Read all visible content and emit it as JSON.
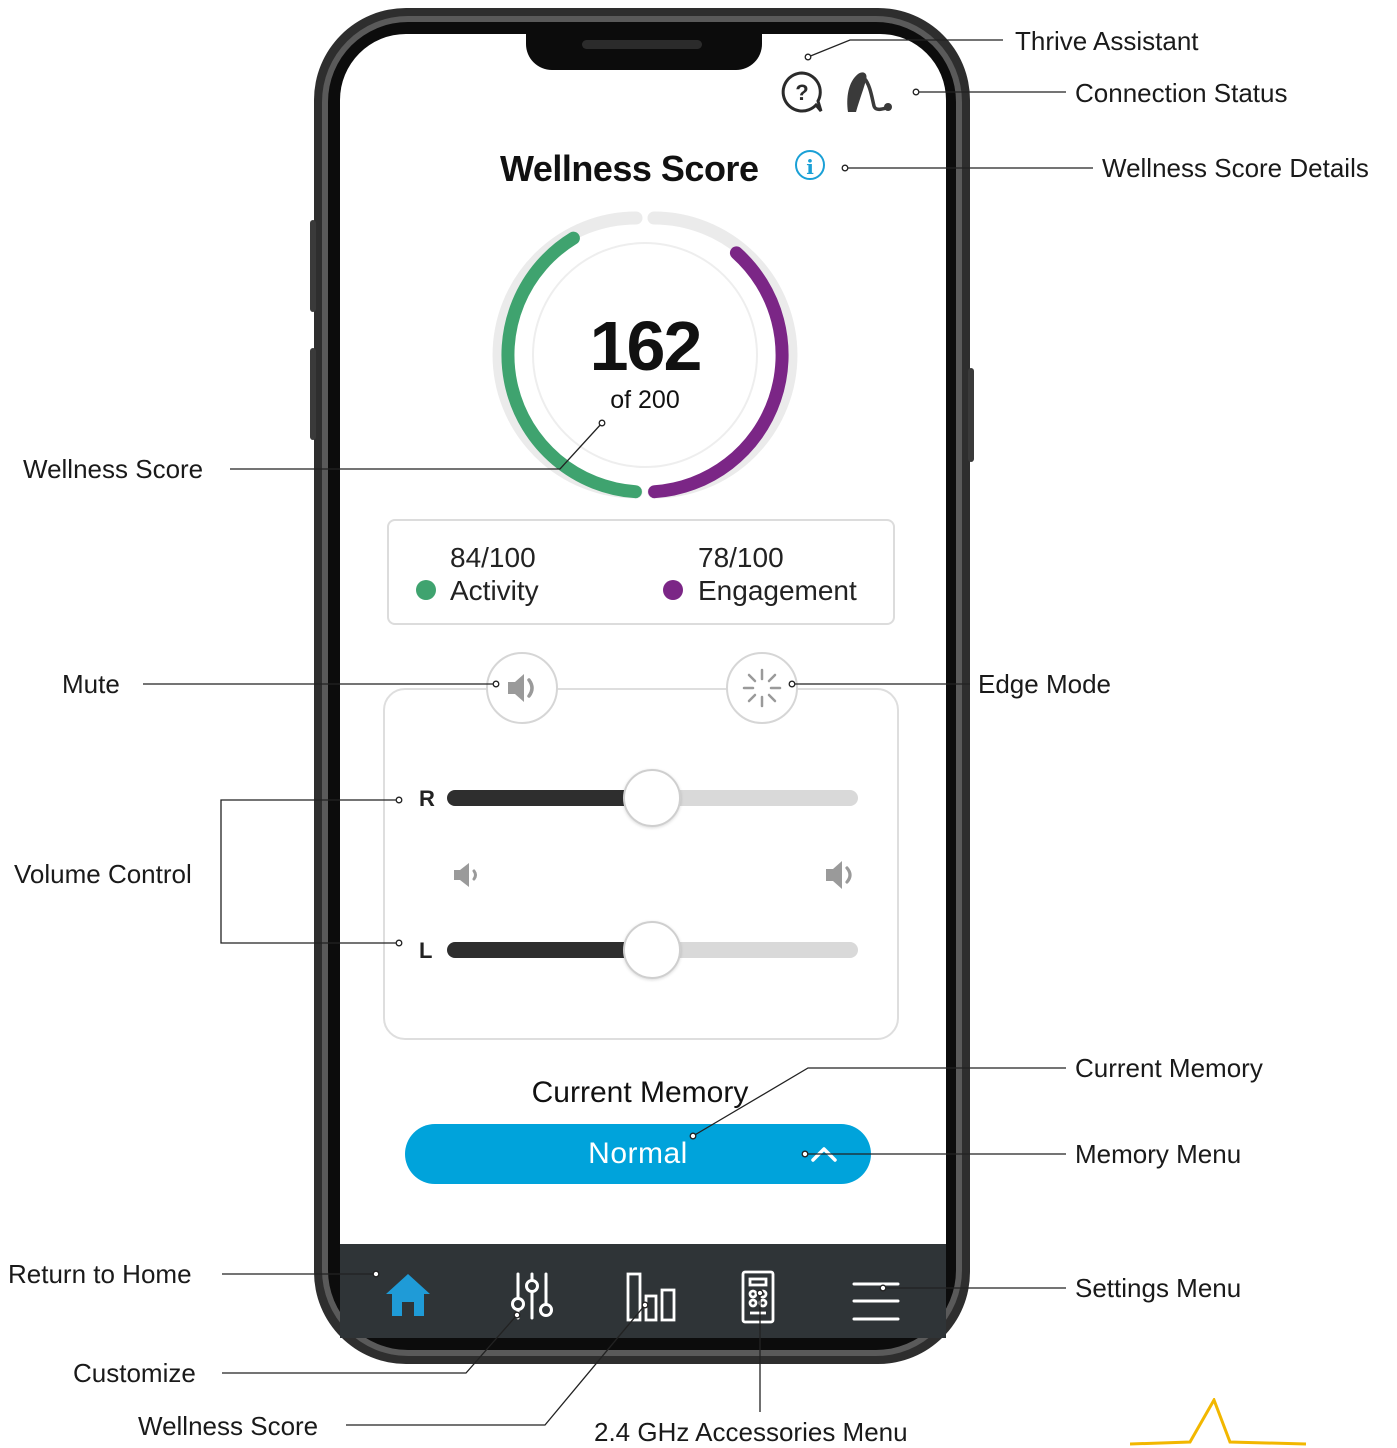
{
  "annotations": {
    "thrive_assistant": "Thrive Assistant",
    "connection_status": "Connection Status",
    "wellness_score_details": "Wellness Score Details",
    "wellness_score": "Wellness Score",
    "mute": "Mute",
    "edge_mode": "Edge Mode",
    "volume_control": "Volume Control",
    "current_memory": "Current Memory",
    "memory_menu": "Memory Menu",
    "return_to_home": "Return to Home",
    "settings_menu": "Settings Menu",
    "customize": "Customize",
    "wellness_score_tab": "Wellness Score",
    "accessories_menu": "2.4 GHz Accessories Menu"
  },
  "screen": {
    "title": "Wellness Score",
    "score": {
      "value": "162",
      "of_label": "of 200",
      "max": 200,
      "activity_fraction": 0.84,
      "engagement_fraction": 0.78
    },
    "stats": {
      "activity": {
        "value": "84/100",
        "label": "Activity",
        "color": "#3fa36f"
      },
      "engagement": {
        "value": "78/100",
        "label": "Engagement",
        "color": "#7b2686"
      }
    },
    "volume": {
      "right_label": "R",
      "left_label": "L",
      "right_level": 0.5,
      "left_level": 0.5
    },
    "memory": {
      "title": "Current Memory",
      "selected": "Normal"
    },
    "colors": {
      "accent": "#00a3db",
      "tabbar": "#2f3437",
      "home_active": "#1f9bd7"
    },
    "tabs": [
      {
        "icon": "home-icon",
        "active": true
      },
      {
        "icon": "sliders-icon",
        "active": false
      },
      {
        "icon": "bar-chart-icon",
        "active": false
      },
      {
        "icon": "remote-icon",
        "active": false
      },
      {
        "icon": "hamburger-icon",
        "active": false
      }
    ]
  }
}
